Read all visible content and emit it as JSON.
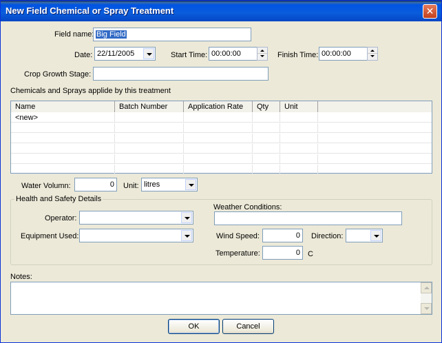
{
  "window": {
    "title": "New Field Chemical or Spray Treatment",
    "close_glyph": "✕"
  },
  "form": {
    "field_name": {
      "label": "Field name:",
      "value": "Big Field"
    },
    "date": {
      "label": "Date:",
      "value": "22/11/2005"
    },
    "start_time": {
      "label": "Start Time:",
      "value": "00:00:00"
    },
    "finish_time": {
      "label": "Finish Time:",
      "value": "00:00:00"
    },
    "crop_growth_stage": {
      "label": "Crop Growth  Stage:",
      "value": ""
    }
  },
  "chemicals": {
    "section_label": "Chemicals and Sprays applide by this treatment",
    "columns": [
      "Name",
      "Batch Number",
      "Application Rate",
      "Qty",
      "Unit"
    ],
    "rows": [
      [
        "<new>",
        "",
        "",
        "",
        ""
      ],
      [
        "",
        "",
        "",
        "",
        ""
      ],
      [
        "",
        "",
        "",
        "",
        ""
      ],
      [
        "",
        "",
        "",
        "",
        ""
      ],
      [
        "",
        "",
        "",
        "",
        ""
      ],
      [
        "",
        "",
        "",
        "",
        ""
      ]
    ]
  },
  "water": {
    "volume_label": "Water Volumn:",
    "volume_value": "0",
    "unit_label": "Unit:",
    "unit_value": "litres"
  },
  "health_safety": {
    "legend": "Health and Safety Details",
    "operator_label": "Operator:",
    "operator_value": "",
    "equipment_label": "Equipment Used:",
    "equipment_value": "",
    "weather_label": "Weather Conditions:",
    "weather_value": "",
    "wind_speed_label": "Wind Speed:",
    "wind_speed_value": "0",
    "direction_label": "Direction:",
    "direction_value": "",
    "temperature_label": "Temperature:",
    "temperature_value": "0",
    "temperature_unit": "C"
  },
  "notes": {
    "label": "Notes:",
    "value": ""
  },
  "buttons": {
    "ok": "OK",
    "cancel": "Cancel"
  }
}
